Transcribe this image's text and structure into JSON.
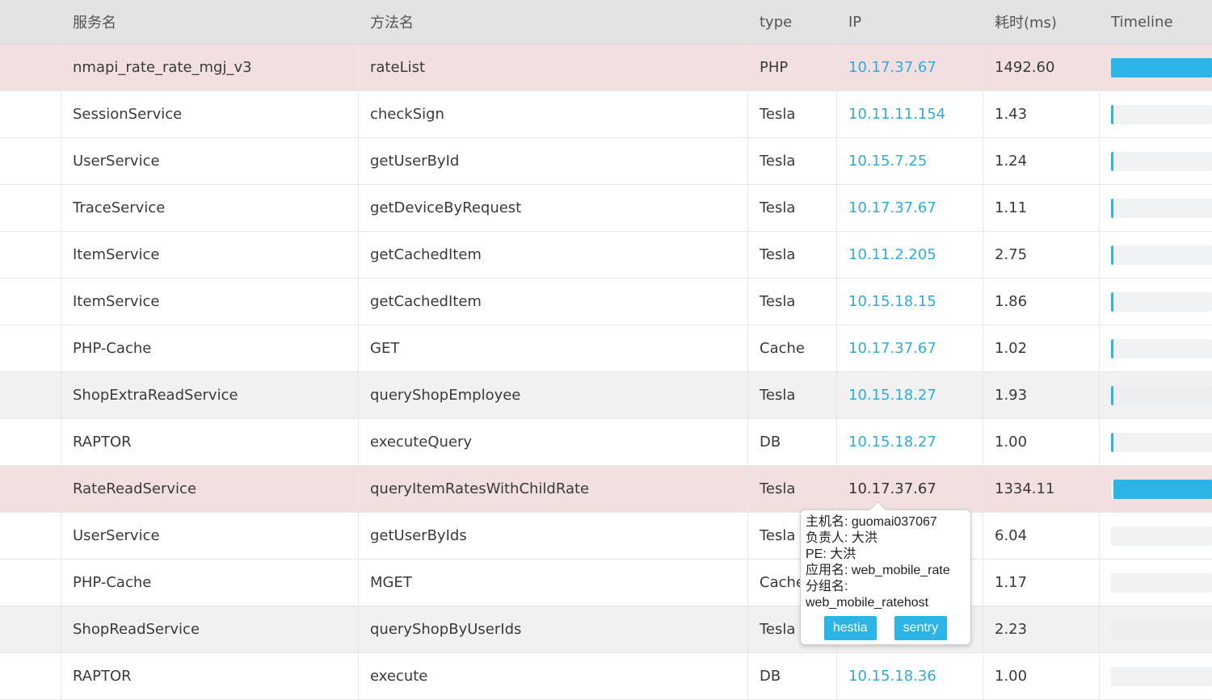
{
  "columns": {
    "service": "服务名",
    "method": "方法名",
    "type": "type",
    "ip": "IP",
    "duration": "耗时(ms)",
    "timeline": "Timeline"
  },
  "colors": {
    "highlight_row": "#f2e0e1",
    "link": "#33aadd",
    "bar": "#2cb4e6"
  },
  "rows": [
    {
      "service": "nmapi_rate_rate_mgj_v3",
      "method": "rateList",
      "type": "PHP",
      "ip": "10.17.37.67",
      "duration": "1492.60",
      "timeline": 1.0
    },
    {
      "service": "SessionService",
      "method": "checkSign",
      "type": "Tesla",
      "ip": "10.11.11.154",
      "duration": "1.43",
      "timeline": 0.02
    },
    {
      "service": "UserService",
      "method": "getUserById",
      "type": "Tesla",
      "ip": "10.15.7.25",
      "duration": "1.24",
      "timeline": 0.02
    },
    {
      "service": "TraceService",
      "method": "getDeviceByRequest",
      "type": "Tesla",
      "ip": "10.17.37.67",
      "duration": "1.11",
      "timeline": 0.02
    },
    {
      "service": "ItemService",
      "method": "getCachedItem",
      "type": "Tesla",
      "ip": "10.11.2.205",
      "duration": "2.75",
      "timeline": 0.02
    },
    {
      "service": "ItemService",
      "method": "getCachedItem",
      "type": "Tesla",
      "ip": "10.15.18.15",
      "duration": "1.86",
      "timeline": 0.02
    },
    {
      "service": "PHP-Cache",
      "method": "GET",
      "type": "Cache",
      "ip": "10.17.37.67",
      "duration": "1.02",
      "timeline": 0.02
    },
    {
      "service": "ShopExtraReadService",
      "method": "queryShopEmployee",
      "type": "Tesla",
      "ip": "10.15.18.27",
      "duration": "1.93",
      "timeline": 0.02
    },
    {
      "service": "RAPTOR",
      "method": "executeQuery",
      "type": "DB",
      "ip": "10.15.18.27",
      "duration": "1.00",
      "timeline": 0.02
    },
    {
      "service": "RateReadService",
      "method": "queryItemRatesWithChildRate",
      "type": "Tesla",
      "ip": "10.17.37.67",
      "duration": "1334.11",
      "timeline": 0.98
    },
    {
      "service": "UserService",
      "method": "getUserByIds",
      "type": "Tesla",
      "ip": "",
      "duration": "6.04",
      "timeline": 0.0
    },
    {
      "service": "PHP-Cache",
      "method": "MGET",
      "type": "Cache",
      "ip": "",
      "duration": "1.17",
      "timeline": 0.0
    },
    {
      "service": "ShopReadService",
      "method": "queryShopByUserIds",
      "type": "Tesla",
      "ip": "",
      "duration": "2.23",
      "timeline": 0.0
    },
    {
      "service": "RAPTOR",
      "method": "execute",
      "type": "DB",
      "ip": "10.15.18.36",
      "duration": "1.00",
      "timeline": 0.0
    }
  ],
  "tooltip": {
    "lines": [
      "主机名: guomai037067",
      "负责人: 大洪",
      "PE: 大洪",
      "应用名: web_mobile_rate",
      "分组名:",
      "web_mobile_ratehost"
    ],
    "buttons": [
      "hestia",
      "sentry"
    ]
  }
}
